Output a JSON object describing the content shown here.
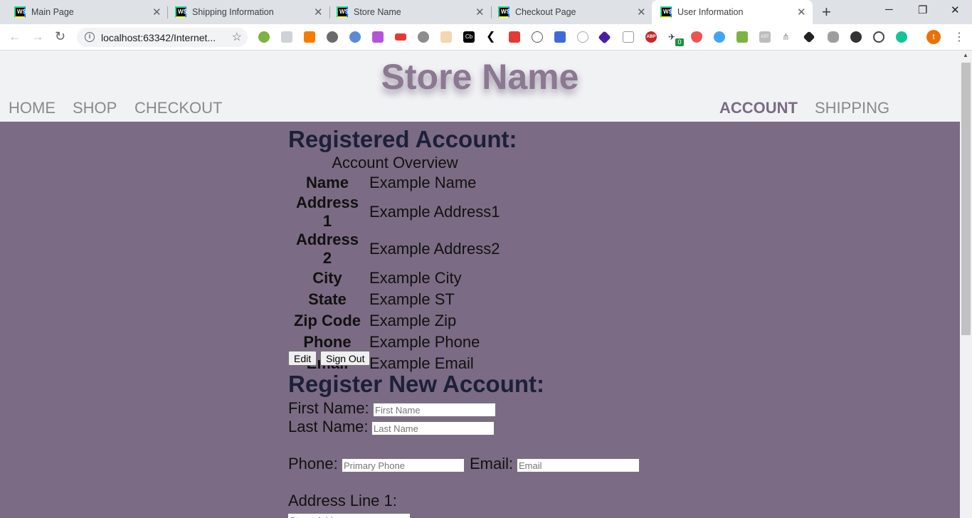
{
  "browser": {
    "tabs": [
      {
        "title": "Main Page",
        "active": false
      },
      {
        "title": "Shipping Information",
        "active": false
      },
      {
        "title": "Store Name",
        "active": false
      },
      {
        "title": "Checkout Page",
        "active": false
      },
      {
        "title": "User Information",
        "active": true
      }
    ],
    "favicon_text": "WS",
    "url": "localhost:63342/Internet...",
    "new_tab": "+",
    "window_controls": {
      "minimize": "─",
      "restore": "❐",
      "close": "✕"
    },
    "profile_initial": "t",
    "extension_badge": "0",
    "extension_abp": "ABP",
    "extension_ast": "AST",
    "extension_cb": "Cb"
  },
  "header": {
    "store_name": "Store Name",
    "nav_left": [
      "HOME",
      "SHOP",
      "CHECKOUT"
    ],
    "nav_right": [
      "ACCOUNT",
      "SHIPPING"
    ],
    "current": "ACCOUNT"
  },
  "registered": {
    "heading": "Registered Account:",
    "caption": "Account Overview",
    "rows": [
      {
        "label": "Name",
        "value": "Example Name"
      },
      {
        "label": "Address 1",
        "value": "Example Address1"
      },
      {
        "label": "Address 2",
        "value": "Example Address2"
      },
      {
        "label": "City",
        "value": "Example City"
      },
      {
        "label": "State",
        "value": "Example ST"
      },
      {
        "label": "Zip Code",
        "value": "Example Zip"
      },
      {
        "label": "Phone",
        "value": "Example Phone"
      },
      {
        "label": "Email",
        "value": "Example Email"
      }
    ],
    "edit_label": "Edit",
    "signout_label": "Sign Out"
  },
  "register_new": {
    "heading": "Register New Account:",
    "first_name_label": "First Name:",
    "first_name_placeholder": "First Name",
    "last_name_label": "Last Name:",
    "last_name_placeholder": "Last Name",
    "phone_label": "Phone:",
    "phone_placeholder": "Primary Phone",
    "email_label": "Email:",
    "email_placeholder": "Email",
    "address1_label": "Address Line 1:",
    "address1_placeholder": "Street Address"
  },
  "colors": {
    "content_bg": "#7c6b84",
    "header_bg": "#f1f2f4",
    "heading": "#1c2039",
    "store_name": "#8b7891"
  }
}
